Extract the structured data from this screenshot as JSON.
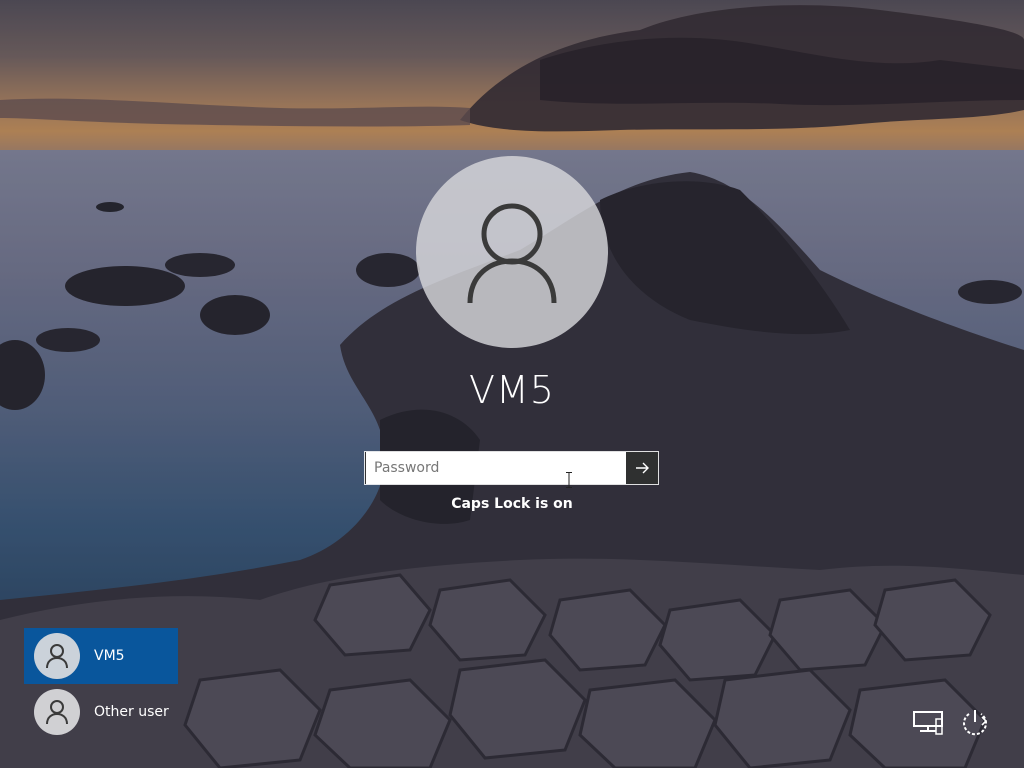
{
  "login": {
    "username": "VM5",
    "password_placeholder": "Password",
    "password_value": "",
    "caps_lock_message": "Caps Lock is on",
    "submit_icon": "arrow-right-icon",
    "avatar_icon": "user-icon"
  },
  "user_list": [
    {
      "name": "VM5",
      "selected": true,
      "icon": "user-icon"
    },
    {
      "name": "Other user",
      "selected": false,
      "icon": "user-icon"
    }
  ],
  "system_icons": {
    "network": "network-icon",
    "power": "power-icon"
  },
  "colors": {
    "selected_user_bg": "#005aaa",
    "submit_button_bg": "#2f3030",
    "text": "#ffffff"
  }
}
